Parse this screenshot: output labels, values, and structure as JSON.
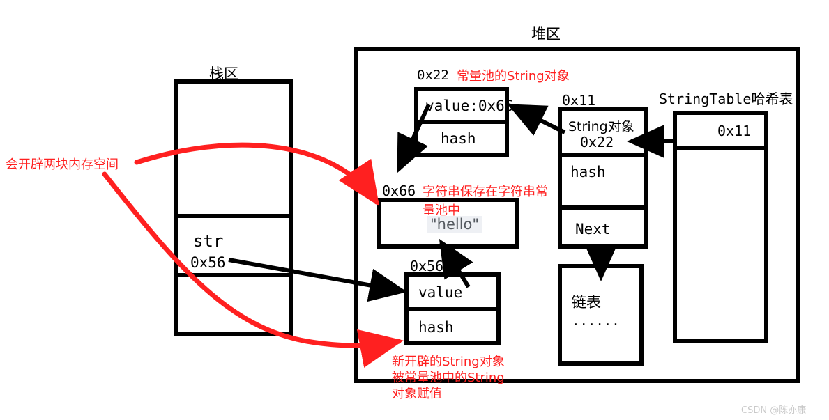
{
  "diagram": {
    "stack": {
      "title": "栈区",
      "cells": [
        {
          "line1": "",
          "line2": ""
        },
        {
          "line1": "str",
          "line2": "0x56"
        },
        {
          "line1": "",
          "line2": ""
        }
      ]
    },
    "heap": {
      "title": "堆区",
      "pool_object": {
        "address": "0x22",
        "note": "常量池的String对象",
        "fields": [
          "value:0x66",
          "hash"
        ]
      },
      "literal": {
        "address": "0x66",
        "note_line1": "字符串保存在字符串常",
        "note_line2": "量池中",
        "value": "\"hello\""
      },
      "new_object": {
        "address": "0x56",
        "fields": [
          "value",
          "hash"
        ]
      },
      "table_entry": {
        "address": "0x11",
        "fields": [
          "String对象",
          "0x22",
          "hash",
          "Next"
        ]
      },
      "linked_list": {
        "label": "链表",
        "dots": "......"
      },
      "string_table": {
        "title": "StringTable哈希表",
        "slot": "0x11"
      }
    },
    "annotations": {
      "left_note": "会开辟两块内存空间",
      "bottom_note_line1": "新开辟的String对象",
      "bottom_note_line2": "被常量池中的String",
      "bottom_note_line3": "对象赋值"
    },
    "watermark": "CSDN @陈亦康",
    "colors": {
      "ink": "#000000",
      "accent_red": "#ff2020",
      "highlight": "#eef0f4",
      "watermark": "#c9c9c9"
    }
  }
}
